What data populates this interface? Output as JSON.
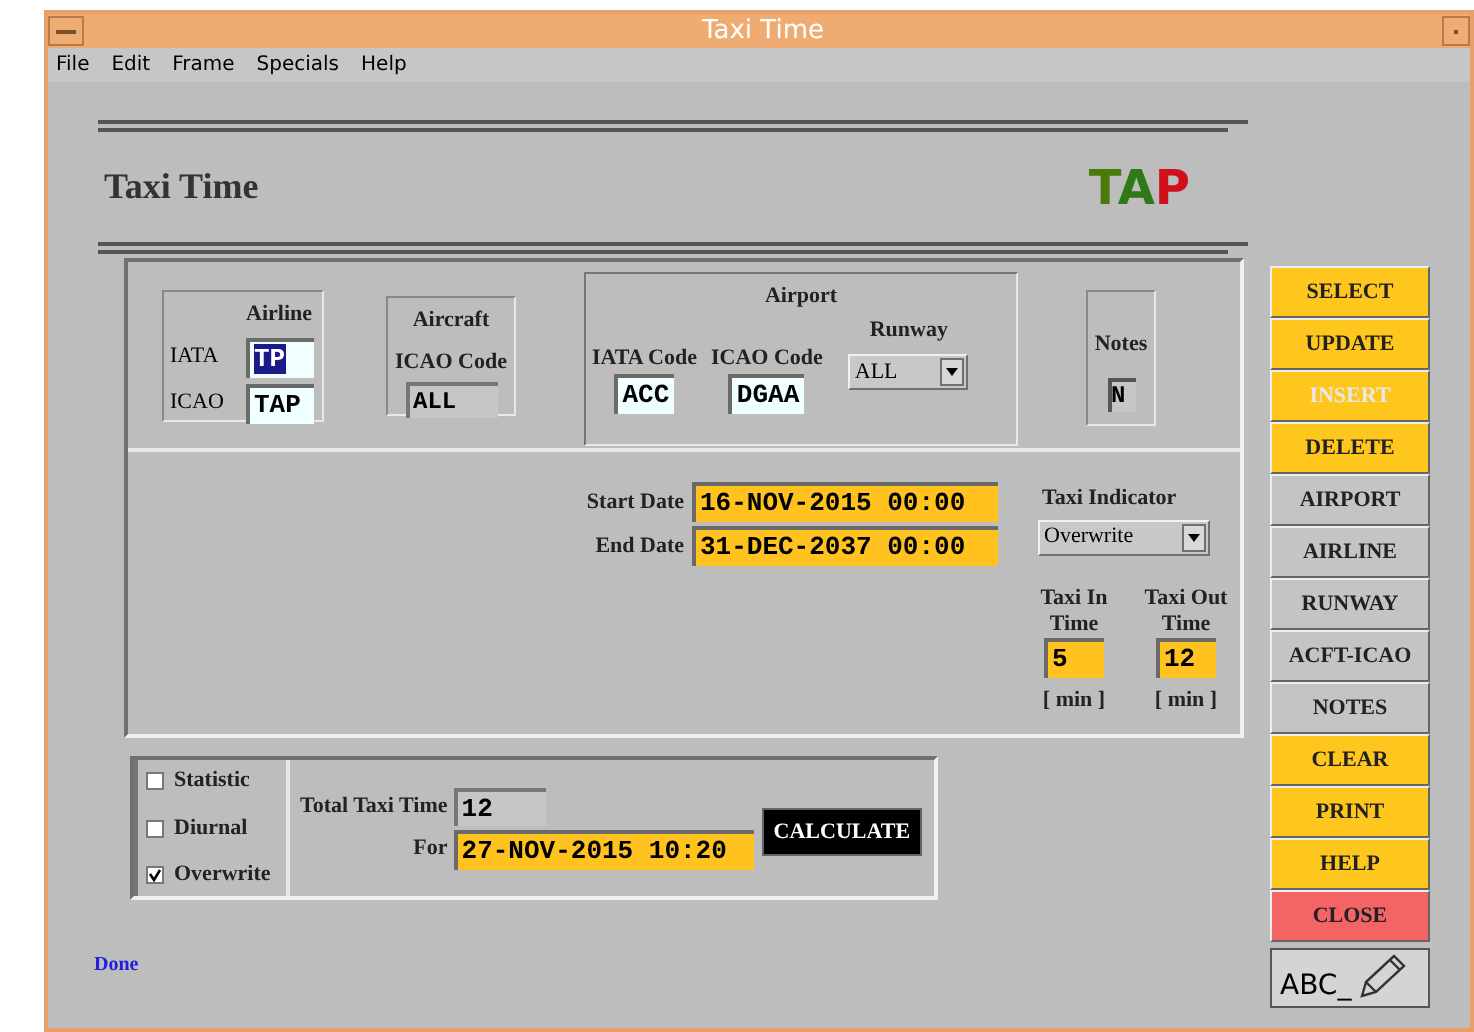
{
  "window": {
    "title": "Taxi Time"
  },
  "menu": [
    "File",
    "Edit",
    "Frame",
    "Specials",
    "Help"
  ],
  "header": {
    "title": "Taxi Time",
    "logo": "TAP"
  },
  "airline": {
    "title": "Airline",
    "fields": [
      {
        "label": "IATA",
        "value": "TP",
        "selected": true
      },
      {
        "label": "ICAO",
        "value": "TAP",
        "selected": false
      }
    ]
  },
  "aircraft": {
    "title": "Aircraft",
    "label": "ICAO Code",
    "value": "ALL"
  },
  "airport": {
    "title": "Airport",
    "iata": {
      "label": "IATA Code",
      "value": "ACC"
    },
    "icao": {
      "label": "ICAO Code",
      "value": "DGAA"
    },
    "runway": {
      "label": "Runway",
      "value": "ALL"
    }
  },
  "notes": {
    "label": "Notes",
    "value": "N"
  },
  "dates": [
    {
      "label": "Start Date",
      "value": "16-NOV-2015 00:00"
    },
    {
      "label": "End Date",
      "value": "31-DEC-2037 00:00"
    }
  ],
  "taxi_indicator": {
    "label": "Taxi Indicator",
    "value": "Overwrite"
  },
  "taxi_times": [
    {
      "label": "Taxi In Time",
      "value": "5",
      "unit": "[ min ]"
    },
    {
      "label": "Taxi Out Time",
      "value": "12",
      "unit": "[ min ]"
    }
  ],
  "options": [
    {
      "label": "Statistic",
      "checked": false
    },
    {
      "label": "Diurnal",
      "checked": false
    },
    {
      "label": "Overwrite",
      "checked": true
    }
  ],
  "total": {
    "label": "Total Taxi Time",
    "value": "12"
  },
  "for": {
    "label": "For",
    "value": "27-NOV-2015 10:20"
  },
  "calculate": "CALCULATE",
  "buttons": [
    {
      "label": "SELECT",
      "kind": "action",
      "disabled": false
    },
    {
      "label": "UPDATE",
      "kind": "action",
      "disabled": false
    },
    {
      "label": "INSERT",
      "kind": "action",
      "disabled": true
    },
    {
      "label": "DELETE",
      "kind": "action",
      "disabled": false
    },
    {
      "label": "AIRPORT",
      "kind": "lookup",
      "disabled": false
    },
    {
      "label": "AIRLINE",
      "kind": "lookup",
      "disabled": false
    },
    {
      "label": "RUNWAY",
      "kind": "lookup",
      "disabled": false
    },
    {
      "label": "ACFT-ICAO",
      "kind": "lookup",
      "disabled": false
    },
    {
      "label": "NOTES",
      "kind": "lookup",
      "disabled": false
    },
    {
      "label": "CLEAR",
      "kind": "action",
      "disabled": false
    },
    {
      "label": "PRINT",
      "kind": "action",
      "disabled": false
    },
    {
      "label": "HELP",
      "kind": "action",
      "disabled": false
    },
    {
      "label": "CLOSE",
      "kind": "danger",
      "disabled": false
    }
  ],
  "abc_button": "ABC_",
  "status": "Done"
}
